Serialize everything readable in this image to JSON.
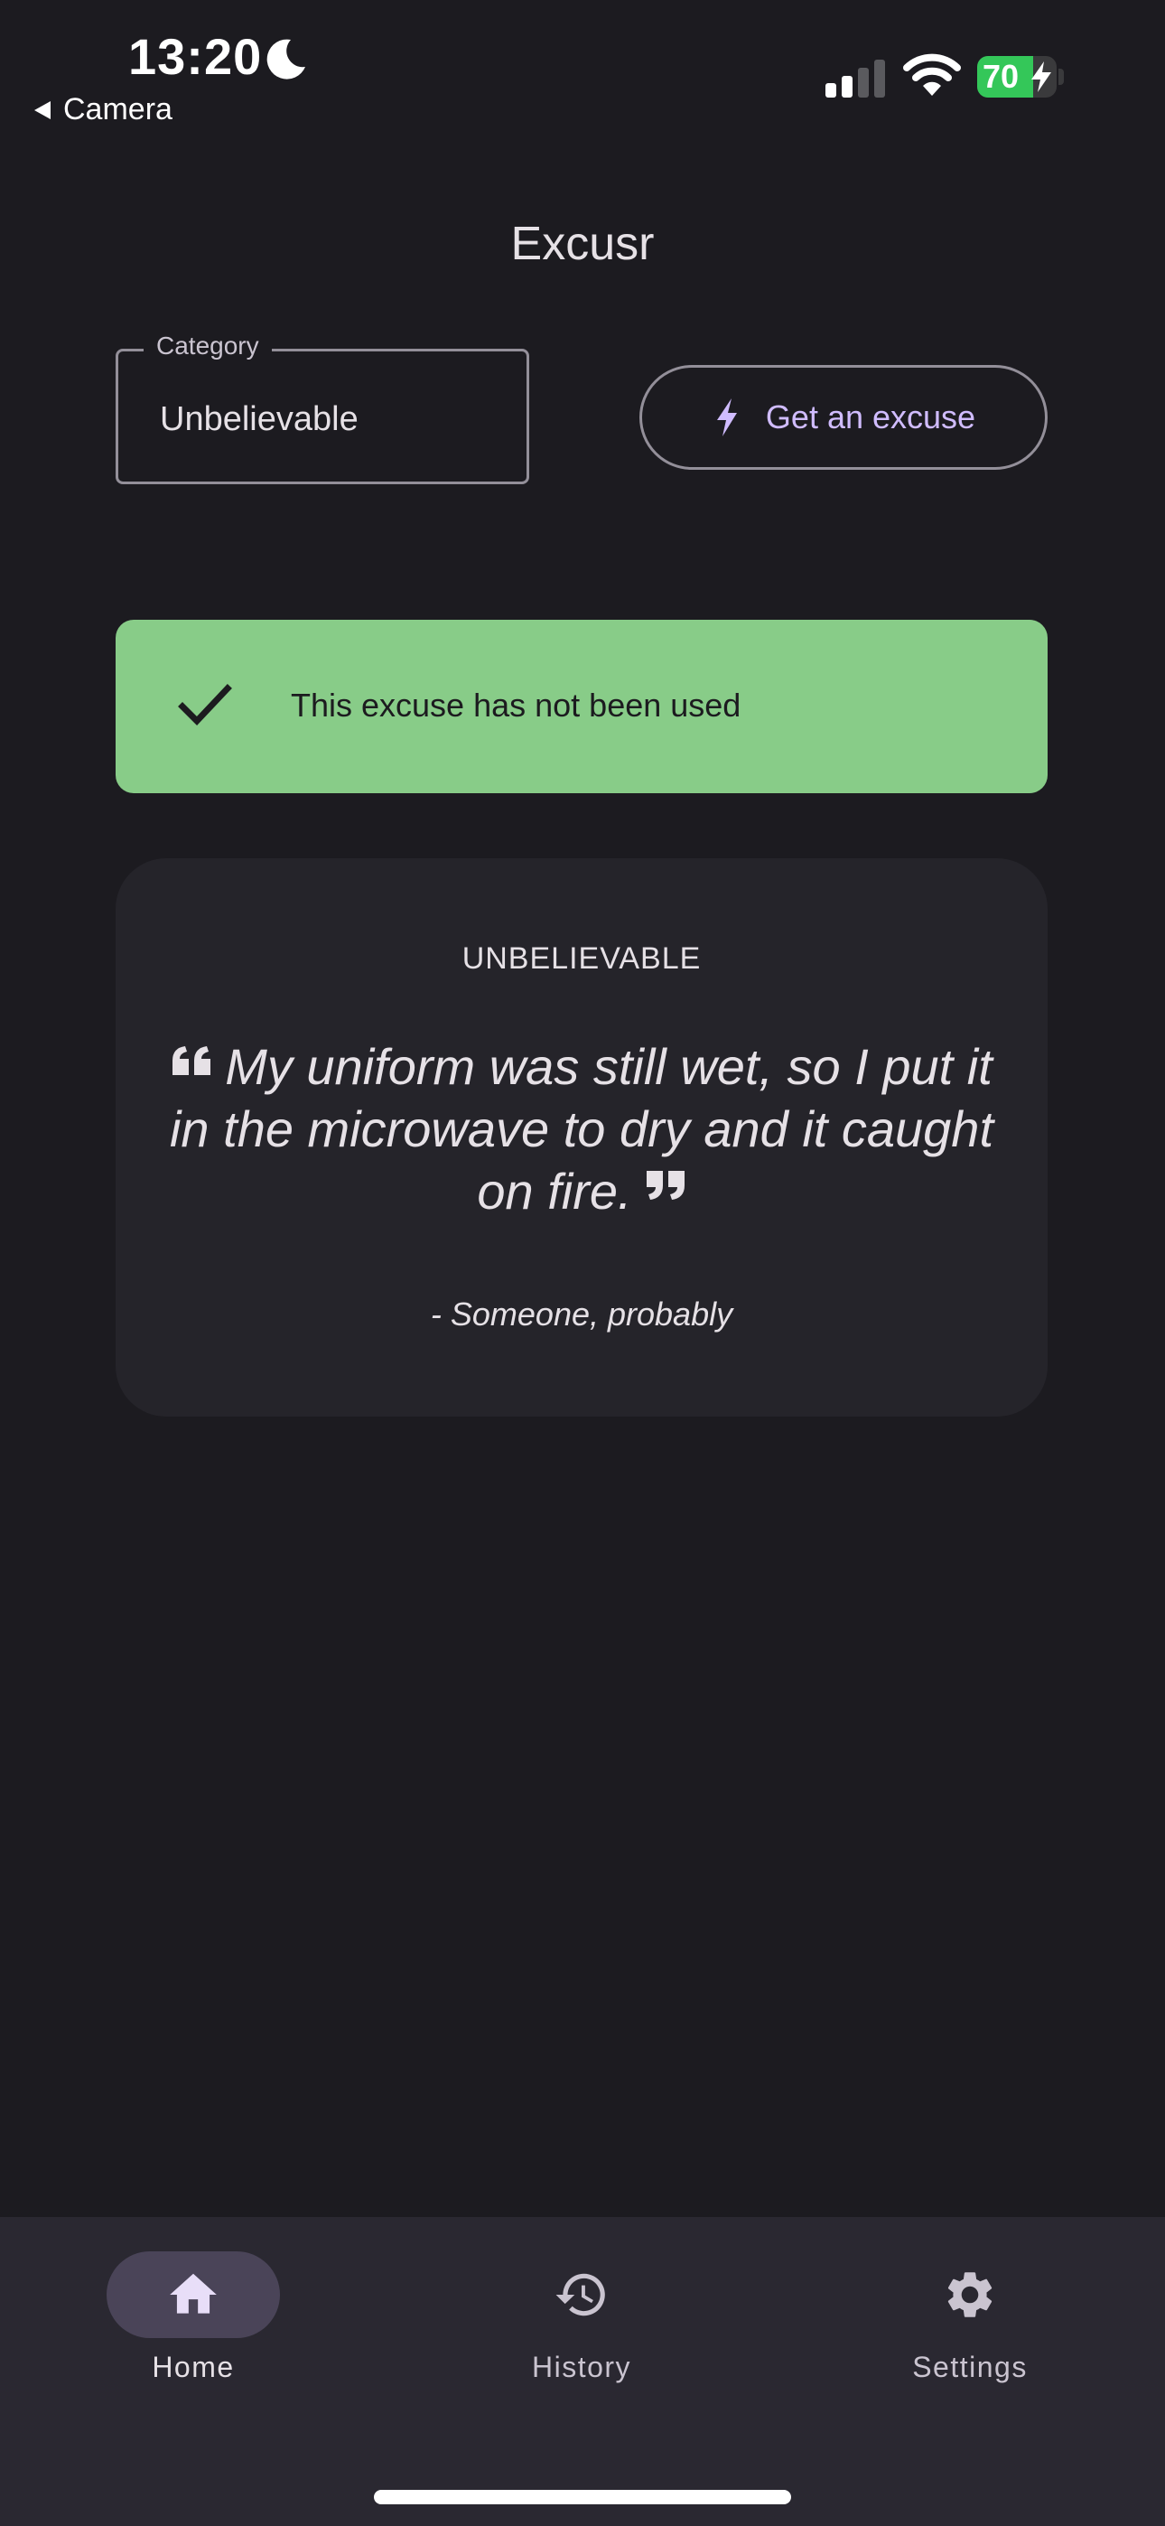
{
  "status_bar": {
    "time": "13:20",
    "back_label": "Camera",
    "battery_percent": "70",
    "battery_level": 0.7
  },
  "app": {
    "title": "Excusr"
  },
  "category_field": {
    "label": "Category",
    "value": "Unbelievable"
  },
  "excuse_button": {
    "label": "Get an excuse",
    "icon": "bolt-icon"
  },
  "status_banner": {
    "text": "This excuse has not been used",
    "icon": "check-icon",
    "color": "#88cc88"
  },
  "excuse_card": {
    "category": "UNBELIEVABLE",
    "text": "My uniform was still wet, so I put it in the microwave to dry and it caught on fire.",
    "attribution": "- Someone, probably"
  },
  "bottom_nav": {
    "items": [
      {
        "label": "Home",
        "icon": "home-icon",
        "active": true
      },
      {
        "label": "History",
        "icon": "history-icon",
        "active": false
      },
      {
        "label": "Settings",
        "icon": "gear-icon",
        "active": false
      }
    ]
  },
  "colors": {
    "background": "#1c1b20",
    "accent": "#d0bcff",
    "nav_background": "#2a2831",
    "active_pill": "#4a4458",
    "battery_green": "#34c759"
  }
}
